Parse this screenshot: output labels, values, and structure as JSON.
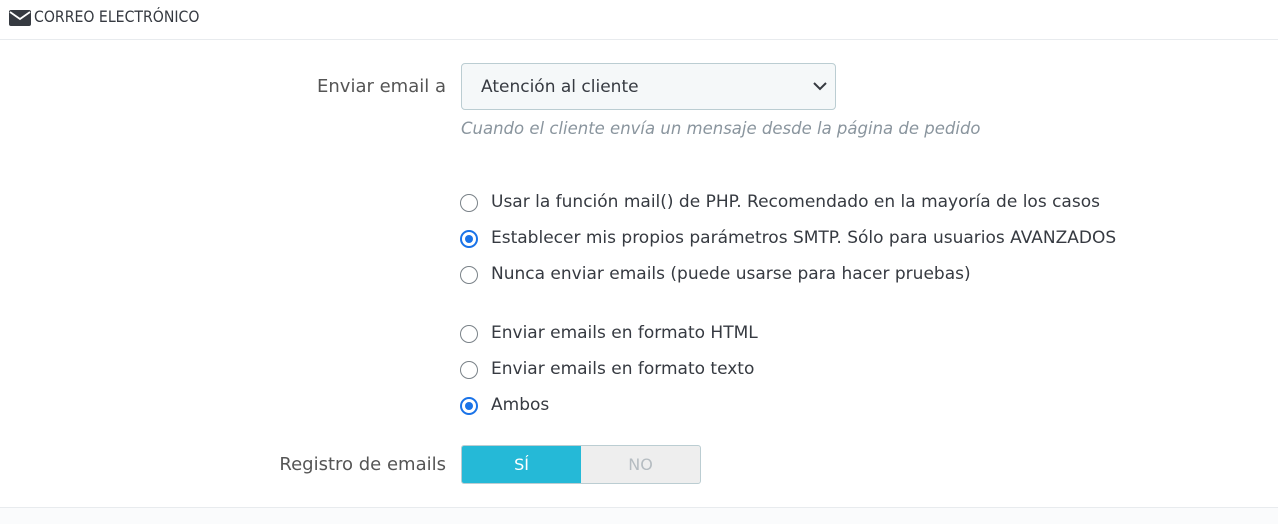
{
  "header": {
    "title": "CORREO ELECTRÓNICO",
    "icon": "envelope-icon"
  },
  "send_email": {
    "label": "Enviar email a",
    "selected": "Atención al cliente",
    "help": "Cuando el cliente envía un mensaje desde la página de pedido"
  },
  "mail_method": {
    "options": [
      {
        "label": "Usar la función mail() de PHP. Recomendado en la mayoría de los casos",
        "checked": false
      },
      {
        "label": "Establecer mis propios parámetros SMTP. Sólo para usuarios AVANZADOS",
        "checked": true
      },
      {
        "label": "Nunca enviar emails (puede usarse para hacer pruebas)",
        "checked": false
      }
    ]
  },
  "mail_format": {
    "options": [
      {
        "label": "Enviar emails en formato HTML",
        "checked": false
      },
      {
        "label": "Enviar emails en formato texto",
        "checked": false
      },
      {
        "label": "Ambos",
        "checked": true
      }
    ]
  },
  "email_log": {
    "label": "Registro de emails",
    "yes": "SÍ",
    "no": "NO",
    "value": "yes"
  },
  "colors": {
    "accent": "#25b9d7",
    "radio": "#1a73e8"
  }
}
